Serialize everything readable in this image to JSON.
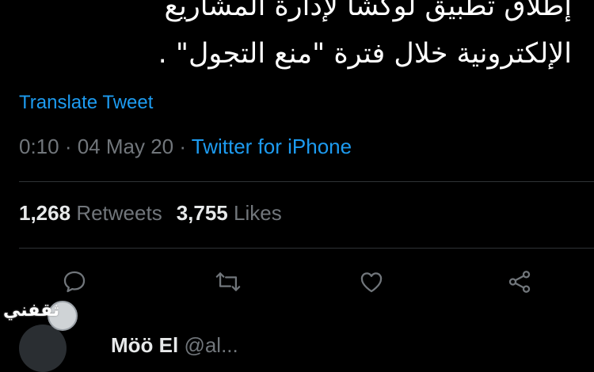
{
  "tweet": {
    "text_line1": "إطلاق تطبيق لوكشا لإدارة المشاريع",
    "text_line2": "الإلكترونية خلال فترة \"منع التجول\" ."
  },
  "translate_label": "Translate Tweet",
  "meta": {
    "time": "0:10",
    "separator1": " · ",
    "date": "04 May 20",
    "separator2": " · ",
    "source": "Twitter for iPhone"
  },
  "stats": {
    "retweets_count": "1,268",
    "retweets_label": "Retweets",
    "likes_count": "3,755",
    "likes_label": "Likes"
  },
  "actions": {
    "reply_icon": "reply-icon",
    "retweet_icon": "retweet-icon",
    "like_icon": "heart-icon",
    "share_icon": "share-icon"
  },
  "next_reply": {
    "name": "Möö El",
    "handle": "@al..."
  },
  "watermark": {
    "text": "ثقفني"
  },
  "colors": {
    "background": "#000000",
    "text": "#e7e9ea",
    "muted": "#71767b",
    "link": "#1d9bf0",
    "divider": "#2f3336"
  }
}
